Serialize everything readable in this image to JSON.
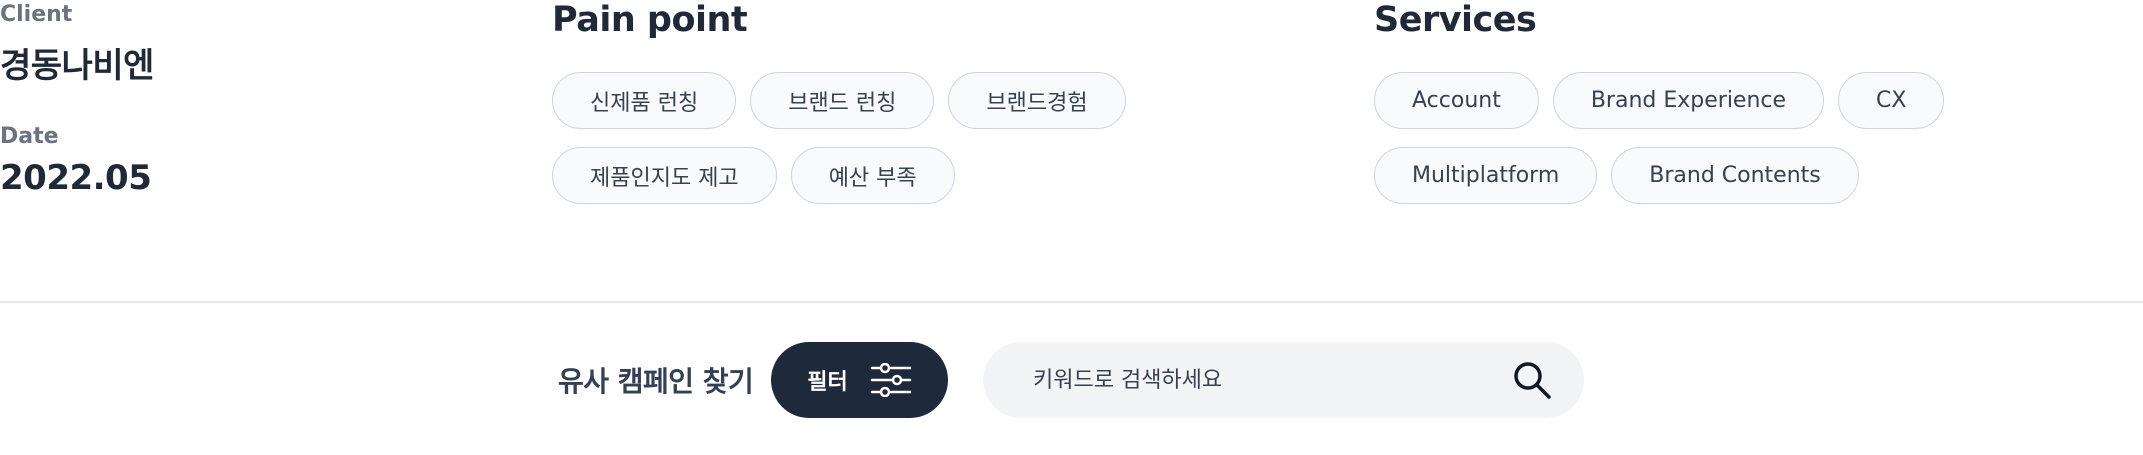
{
  "client": {
    "label": "Client",
    "value": "경동나비엔"
  },
  "date": {
    "label": "Date",
    "value": "2022.05"
  },
  "pain_point": {
    "title": "Pain point",
    "chips": [
      "신제품 런칭",
      "브랜드 런칭",
      "브랜드경험",
      "제품인지도 제고",
      "예산 부족"
    ]
  },
  "services": {
    "title": "Services",
    "chips": [
      "Account",
      "Brand Experience",
      "CX",
      "Multiplatform",
      "Brand Contents"
    ]
  },
  "search_bar": {
    "title": "유사 캠페인 찾기",
    "filter_label": "필터",
    "filter_icon": "sliders-icon",
    "placeholder": "키워드로 검색하세요",
    "search_icon": "search-icon"
  },
  "colors": {
    "text_primary": "#1f2937",
    "text_muted": "#6b7280",
    "filter_button_bg": "#1e293b",
    "chip_border": "#cbd5e1",
    "search_bg": "#f3f4f6"
  }
}
